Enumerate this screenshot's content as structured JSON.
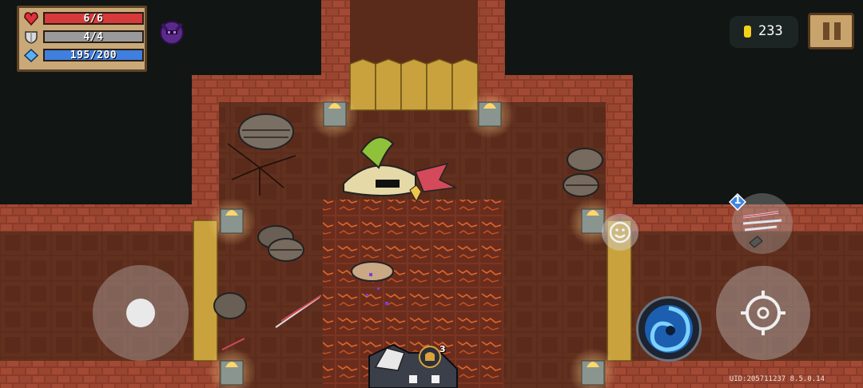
{
  "hud": {
    "hp": {
      "current": 6,
      "max": 6,
      "text": "6/6",
      "icon": "heart-icon",
      "color": "#d63a3a"
    },
    "armor": {
      "current": 4,
      "max": 4,
      "text": "4/4",
      "icon": "shield-icon",
      "color": "#9a9a9a"
    },
    "energy": {
      "current": 195,
      "max": 200,
      "text": "195/200",
      "icon": "energy-crystal-icon",
      "color": "#3f7fe0"
    },
    "buff_icon": "demon-helmet-buff-icon",
    "coins": "233",
    "coin_icon": "gold-coin-icon",
    "pause_icon": "pause-icon"
  },
  "controls": {
    "joystick": "movement-joystick",
    "emote_icon": "smiley-emote-icon",
    "weapon_swap_badge": "1",
    "weapon_swap_icon": "crossbow-weapon-icon",
    "skill_icon": "vortex-skill-icon",
    "attack_icon": "crosshair-attack-icon"
  },
  "player": {
    "level_badge": "3"
  },
  "footer": {
    "uid": "UID:205711237 8.5.0.14"
  }
}
